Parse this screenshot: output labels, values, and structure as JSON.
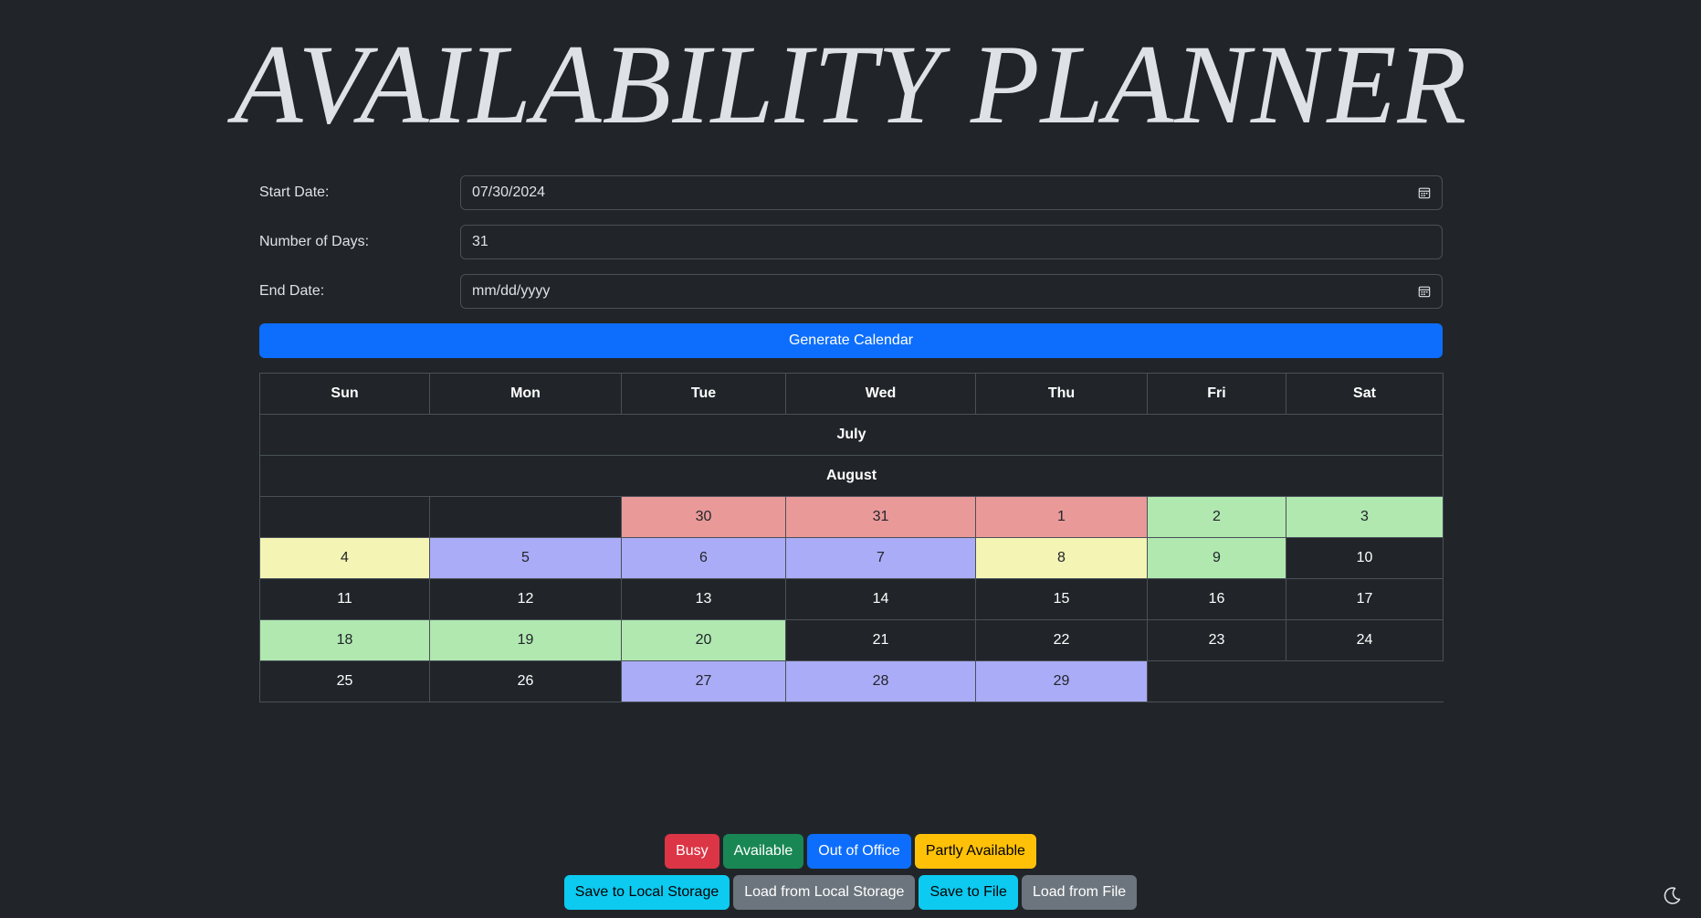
{
  "title": "AVAILABILITY PLANNER",
  "form": {
    "start_date_label": "Start Date:",
    "start_date_value": "07/30/2024",
    "num_days_label": "Number of Days:",
    "num_days_value": "31",
    "end_date_label": "End Date:",
    "end_date_placeholder": "mm/dd/yyyy"
  },
  "generate_label": "Generate Calendar",
  "calendar": {
    "weekdays": [
      "Sun",
      "Mon",
      "Tue",
      "Wed",
      "Thu",
      "Fri",
      "Sat"
    ],
    "months": [
      "July",
      "August"
    ],
    "weeks": [
      [
        {
          "d": ""
        },
        {
          "d": ""
        },
        {
          "d": "30",
          "s": "busy"
        },
        {
          "d": "31",
          "s": "busy"
        },
        {
          "d": "1",
          "s": "busy"
        },
        {
          "d": "2",
          "s": "avail"
        },
        {
          "d": "3",
          "s": "avail"
        }
      ],
      [
        {
          "d": "4",
          "s": "partly"
        },
        {
          "d": "5",
          "s": "ooo"
        },
        {
          "d": "6",
          "s": "ooo"
        },
        {
          "d": "7",
          "s": "ooo"
        },
        {
          "d": "8",
          "s": "partly"
        },
        {
          "d": "9",
          "s": "avail"
        },
        {
          "d": "10"
        }
      ],
      [
        {
          "d": "11"
        },
        {
          "d": "12"
        },
        {
          "d": "13"
        },
        {
          "d": "14"
        },
        {
          "d": "15"
        },
        {
          "d": "16"
        },
        {
          "d": "17"
        }
      ],
      [
        {
          "d": "18",
          "s": "avail"
        },
        {
          "d": "19",
          "s": "avail"
        },
        {
          "d": "20",
          "s": "avail"
        },
        {
          "d": "21"
        },
        {
          "d": "22"
        },
        {
          "d": "23"
        },
        {
          "d": "24"
        }
      ],
      [
        {
          "d": "25"
        },
        {
          "d": "26"
        },
        {
          "d": "27",
          "s": "ooo"
        },
        {
          "d": "28",
          "s": "ooo"
        },
        {
          "d": "29",
          "s": "ooo"
        }
      ]
    ]
  },
  "legend": {
    "busy": "Busy",
    "available": "Available",
    "out_of_office": "Out of Office",
    "partly_available": "Partly Available"
  },
  "actions": {
    "save_local": "Save to Local Storage",
    "load_local": "Load from Local Storage",
    "save_file": "Save to File",
    "load_file": "Load from File"
  },
  "colors": {
    "background": "#212529",
    "busy": "#ea9999",
    "available": "#b0e8b0",
    "out_of_office": "#abacf7",
    "partly_available": "#f4f4b5",
    "primary": "#0d6efd"
  },
  "icons": {
    "calendar": "calendar-icon",
    "theme": "moon-icon"
  }
}
